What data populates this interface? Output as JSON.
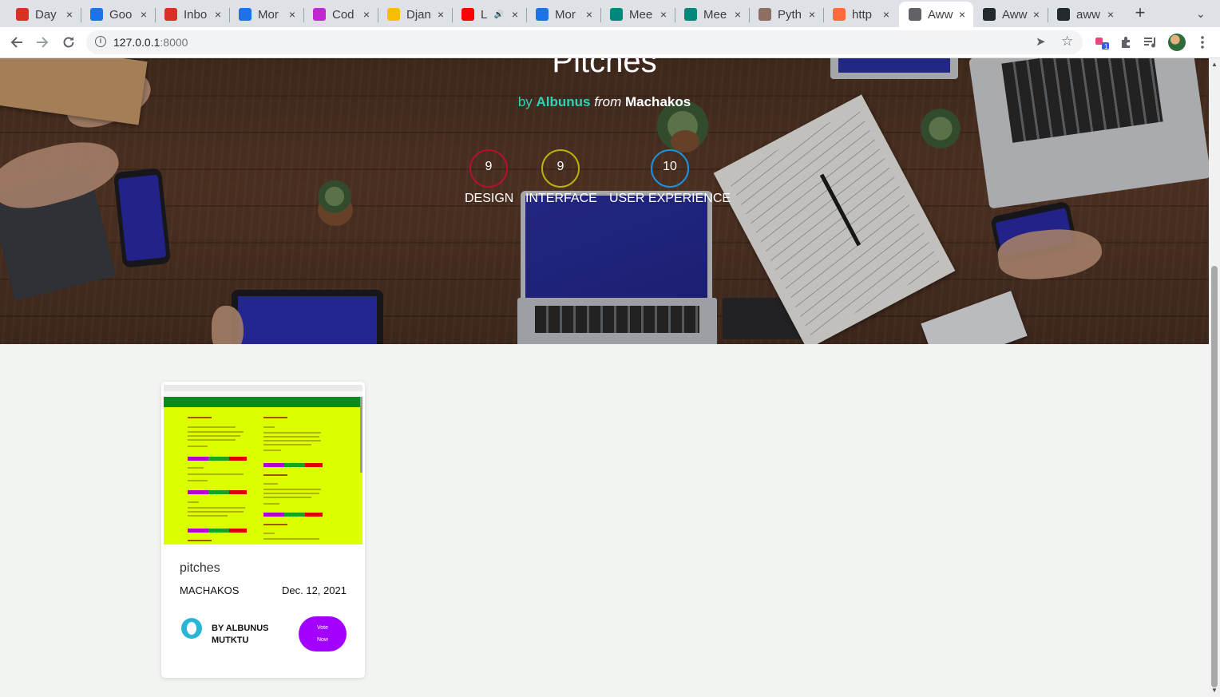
{
  "browser": {
    "tabs": [
      {
        "title": "Day",
        "icon": "gmail-icon",
        "color": "#d93025"
      },
      {
        "title": "Goo",
        "icon": "calendar-icon",
        "color": "#1a73e8"
      },
      {
        "title": "Inbo",
        "icon": "gmail-icon",
        "color": "#d93025"
      },
      {
        "title": "Mor",
        "icon": "calendar-icon",
        "color": "#1a73e8"
      },
      {
        "title": "Cod",
        "icon": "codewars-icon",
        "color": "#c026d3"
      },
      {
        "title": "Djan",
        "icon": "drive-icon",
        "color": "#fbbc04"
      },
      {
        "title": "L",
        "icon": "youtube-icon",
        "color": "#ff0000"
      },
      {
        "title": "Mor",
        "icon": "calendar-icon",
        "color": "#1a73e8"
      },
      {
        "title": "Mee",
        "icon": "meet-icon",
        "color": "#00897b"
      },
      {
        "title": "Mee",
        "icon": "meet-icon",
        "color": "#00897b"
      },
      {
        "title": "Pyth",
        "icon": "palm-icon",
        "color": "#8d6e63"
      },
      {
        "title": "http",
        "icon": "postman-icon",
        "color": "#ff6c37"
      },
      {
        "title": "Aww",
        "icon": "globe-icon",
        "color": "#5f6368"
      },
      {
        "title": "Aww",
        "icon": "github-icon",
        "color": "#24292f"
      },
      {
        "title": "aww",
        "icon": "github-icon",
        "color": "#24292f"
      }
    ],
    "active_tab_index": 12,
    "close_glyph": "×",
    "new_tab_glyph": "+",
    "tab_menu_glyph": "⌄",
    "url_host": "127.0.0.1",
    "url_port": ":8000"
  },
  "hero": {
    "title": "Pitches",
    "by_word": "by",
    "author": "Albunus",
    "from_word": "from",
    "location": "Machakos"
  },
  "ratings": [
    {
      "score": "9",
      "label": "DESIGN",
      "color": "#b3122a"
    },
    {
      "score": "9",
      "label": "INTERFACE",
      "color": "#b8b20a"
    },
    {
      "score": "10",
      "label": "USER EXPERIENCE",
      "color": "#1e90e0"
    }
  ],
  "project": {
    "name": "pitches",
    "location": "MACHAKOS",
    "date": "Dec. 12, 2021",
    "author_line1": "BY ALBUNUS",
    "author_line2": "MUTKTU",
    "vote_line1": "Vote",
    "vote_line2": "Now"
  }
}
